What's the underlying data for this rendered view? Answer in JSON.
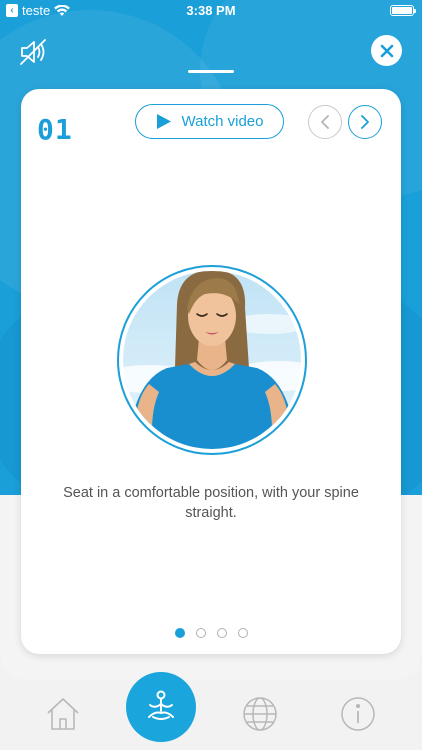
{
  "status_bar": {
    "back_app": "teste",
    "time": "3:38 PM"
  },
  "card": {
    "step_number": "01",
    "watch_video_label": "Watch video",
    "instruction": "Seat in a comfortable position, with your spine straight.",
    "page_dots": {
      "total": 4,
      "active": 0
    }
  },
  "icons": {
    "mute": "speaker-muted-icon",
    "close": "close-icon",
    "play": "play-icon",
    "prev": "chevron-left-icon",
    "next": "chevron-right-icon",
    "home": "home-icon",
    "meditate": "meditation-icon",
    "globe": "globe-icon",
    "info": "info-icon"
  },
  "colors": {
    "accent": "#1a9fd8",
    "background": "#f2f2f2",
    "card": "#ffffff",
    "text": "#555555"
  }
}
